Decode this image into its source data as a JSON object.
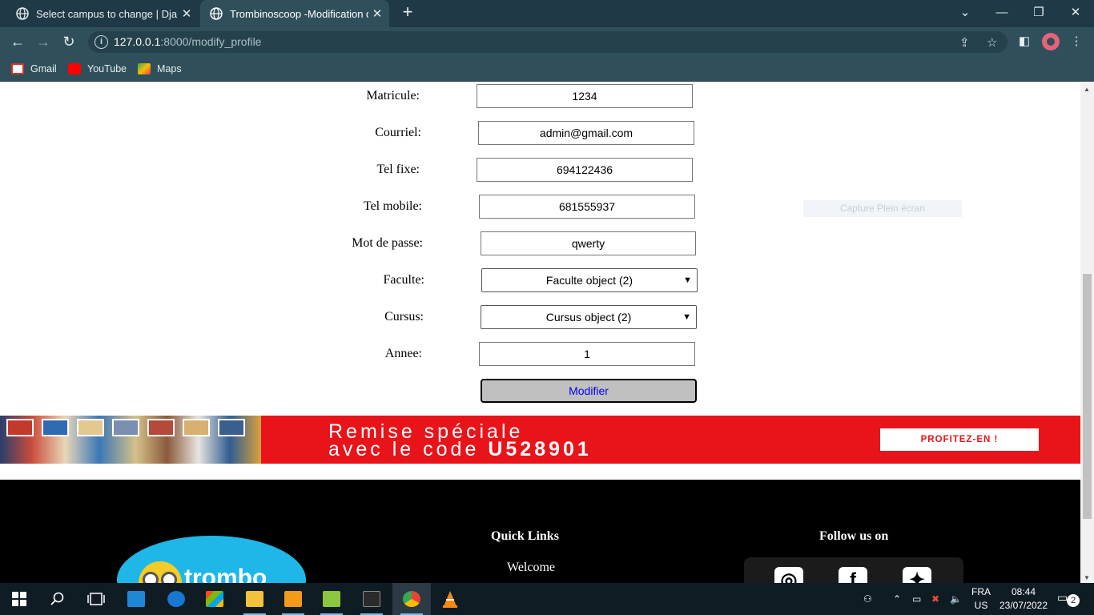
{
  "browser": {
    "tabs": [
      {
        "title": "Select campus to change | Djang"
      },
      {
        "title": "Trombinoscoop -Modification de"
      }
    ],
    "url_host": "127.0.0.1",
    "url_path": ":8000/modify_profile",
    "bookmarks": [
      {
        "label": "Gmail"
      },
      {
        "label": "YouTube"
      },
      {
        "label": "Maps"
      }
    ]
  },
  "form": {
    "matricule_label": "Matricule:",
    "matricule_value": "1234",
    "courriel_label": "Courriel:",
    "courriel_value": "admin@gmail.com",
    "tel_fixe_label": "Tel fixe:",
    "tel_fixe_value": "694122436",
    "tel_mobile_label": "Tel mobile:",
    "tel_mobile_value": "681555937",
    "mdp_label": "Mot de passe:",
    "mdp_value": "qwerty",
    "faculte_label": "Faculte:",
    "faculte_value": "Faculte object (2)",
    "cursus_label": "Cursus:",
    "cursus_value": "Cursus object (2)",
    "annee_label": "Annee:",
    "annee_value": "1",
    "submit_label": "Modifier"
  },
  "capture_label": "Capture Plein écran",
  "banner": {
    "line1": "Remise spéciale",
    "line2_prefix": "avec le code ",
    "code": "U528901",
    "cta": "PROFITEZ-EN !"
  },
  "footer": {
    "logo_text": "trombo",
    "quick_links_title": "Quick Links",
    "link_welcome": "Welcome",
    "follow_title": "Follow us on"
  },
  "taskbar": {
    "lang_top": "FRA",
    "lang_bottom": "US",
    "time": "08:44",
    "date": "23/07/2022",
    "notification_count": "2"
  },
  "colors": {
    "chrome_dark": "#1f3a46",
    "chrome": "#2f4f5b",
    "banner_red": "#e8141a",
    "link_blue": "#0000ee",
    "logo_blue": "#1fb6e8"
  }
}
